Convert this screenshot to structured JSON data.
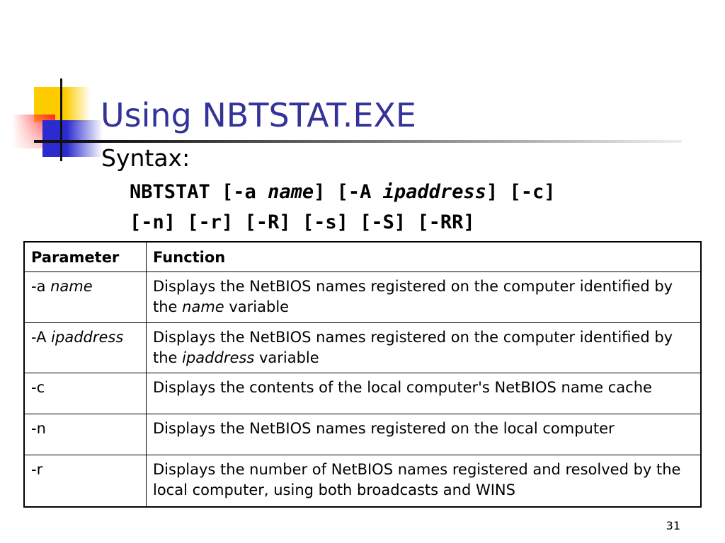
{
  "title": "Using NBTSTAT.EXE",
  "subtitle": "Syntax:",
  "command": {
    "line1": [
      {
        "t": "NBTSTAT [-a "
      },
      {
        "t": "name",
        "i": true
      },
      {
        "t": "] [-A "
      },
      {
        "t": "ipaddress",
        "i": true
      },
      {
        "t": "] [-c]"
      }
    ],
    "line2": "[-n] [-r] [-R] [-s] [-S] [-RR]"
  },
  "table": {
    "headers": [
      "Parameter",
      "Function"
    ],
    "rows": [
      {
        "param": [
          {
            "t": "-a "
          },
          {
            "t": "name",
            "i": true
          }
        ],
        "func": [
          {
            "t": "Displays the NetBIOS names registered on the computer identified by the "
          },
          {
            "t": "name",
            "i": true
          },
          {
            "t": " variable"
          }
        ],
        "h": 72
      },
      {
        "param": [
          {
            "t": "-A "
          },
          {
            "t": "ipaddress",
            "i": true
          }
        ],
        "func": [
          {
            "t": "Displays the NetBIOS names registered on the computer identified by the "
          },
          {
            "t": "ipaddress",
            "i": true
          },
          {
            "t": " variable"
          }
        ],
        "h": 71
      },
      {
        "param": [
          {
            "t": "-c"
          }
        ],
        "func": [
          {
            "t": "Displays the contents of the local computer's NetBIOS name cache"
          }
        ],
        "h": 58
      },
      {
        "param": [
          {
            "t": "-n"
          }
        ],
        "func": [
          {
            "t": "Displays the NetBIOS names registered on the local computer"
          }
        ],
        "h": 58
      },
      {
        "param": [
          {
            "t": "-r"
          }
        ],
        "func": [
          {
            "t": "Displays the number of NetBIOS names registered and resolved by the local computer, using both broadcasts and WINS"
          }
        ],
        "h": 73
      }
    ]
  },
  "page_number": "31"
}
